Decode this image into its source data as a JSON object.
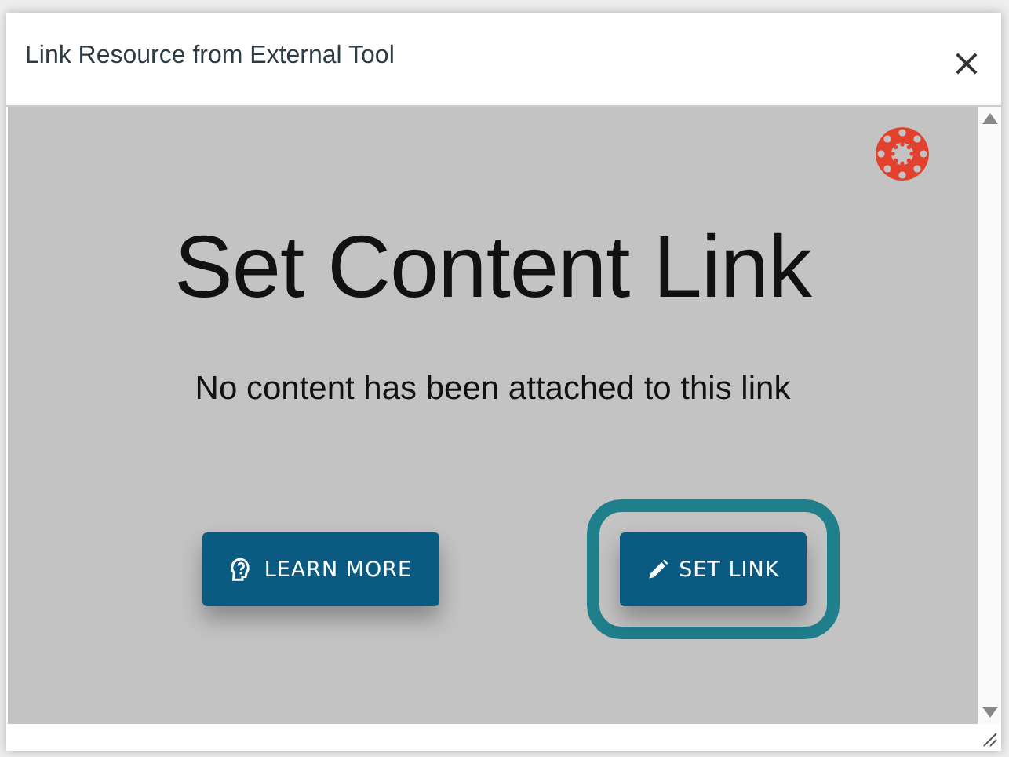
{
  "dialog": {
    "title": "Link Resource from External Tool",
    "close": "×"
  },
  "content": {
    "heading": "Set Content Link",
    "message": "No content has been attached to this link",
    "buttons": [
      {
        "kind": "help",
        "label": "LEARN MORE",
        "focused": false
      },
      {
        "kind": "edit",
        "label": "SET LINK",
        "focused": true
      }
    ]
  }
}
